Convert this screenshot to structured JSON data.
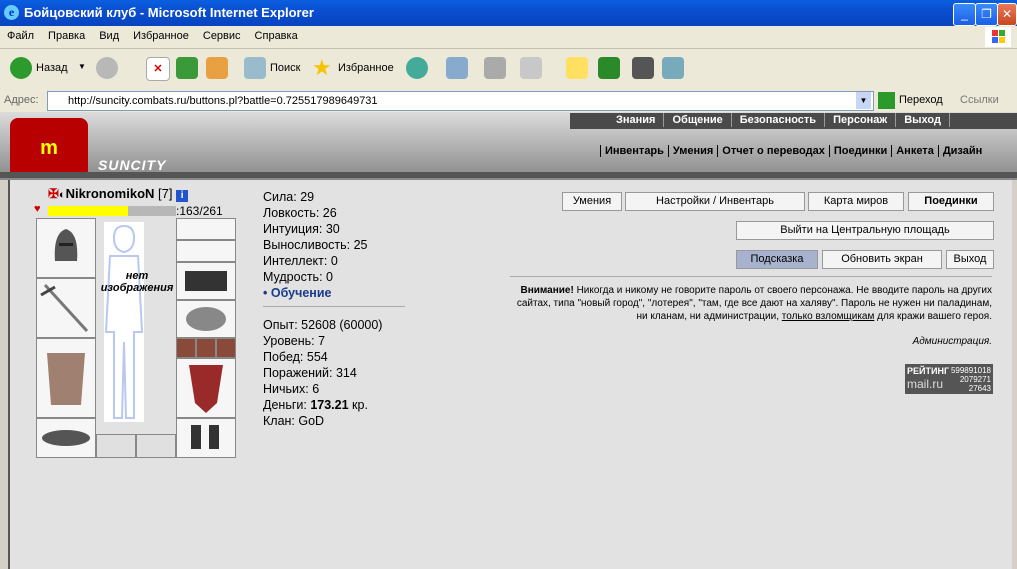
{
  "window": {
    "title": "Бойцовский клуб - Microsoft Internet Explorer"
  },
  "menu": [
    "Файл",
    "Правка",
    "Вид",
    "Избранное",
    "Сервис",
    "Справка"
  ],
  "toolbar": {
    "back": "Назад",
    "search": "Поиск",
    "favorites": "Избранное"
  },
  "address": {
    "label": "Адрес:",
    "url": "http://suncity.combats.ru/buttons.pl?battle=0.725517989649731",
    "go": "Переход",
    "links": "Ссылки"
  },
  "header": {
    "logo_text": "SUNCITY",
    "logo_letter": "m",
    "nav_main": [
      "Знания",
      "Общение",
      "Безопасность",
      "Персонаж",
      "Выход"
    ],
    "nav_sub": [
      "Инвентарь",
      "Умения",
      "Отчет о переводах",
      "Поединки",
      "Анкета",
      "Дизайн"
    ]
  },
  "character": {
    "name": "NikronomikoN",
    "level_badge": "[7]",
    "info_icon": "i",
    "hp_current": 163,
    "hp_max": 261,
    "hp_text": ":163/261",
    "no_image": "нет изображения"
  },
  "stats": [
    "Сила: 29",
    "Ловкость: 26",
    "Интуиция: 30",
    "Выносливость: 25",
    "Интеллект: 0",
    "Мудрость: 0"
  ],
  "training": "Обучение",
  "info": [
    "Опыт: 52608 (60000)",
    "Уровень: 7",
    "Побед: 554",
    "Поражений: 314",
    "Ничьих: 6"
  ],
  "money_label": "Деньги: ",
  "money_value": "173.21",
  "money_unit": " кр.",
  "clan": "Клан: GoD",
  "buttons": {
    "skills": "Умения",
    "settings": "Настройки / Инвентарь",
    "map": "Карта миров",
    "duels": "Поединки",
    "exit_square": "Выйти на Центральную площадь",
    "hint": "Подсказка",
    "refresh": "Обновить экран",
    "exit": "Выход"
  },
  "warning": {
    "label": "Внимание!",
    "text1": " Никогда и никому не говорите пароль от своего персонажа. Не вводите пароль на других сайтах, типа \"новый город\", \"лотерея\", \"там, где все дают на халяву\". Пароль не нужен ни паладинам, ни кланам, ни администрации, ",
    "link": "только взломщикам",
    "text2": " для кражи вашего героя.",
    "admin": "Администрация."
  },
  "rating": {
    "label": "РЕЙТИНГ",
    "site": "mail.ru",
    "n1": "599891018",
    "n2": "2079271",
    "n3": "27643"
  }
}
